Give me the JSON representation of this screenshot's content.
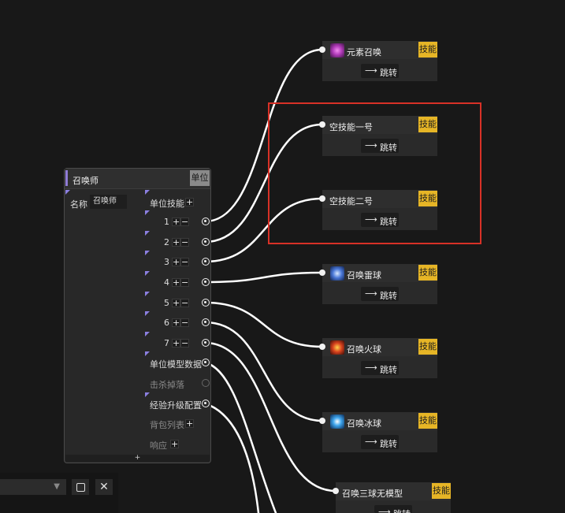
{
  "unit_node": {
    "title": "召唤师",
    "type_label": "单位",
    "name_label": "名称",
    "name_value": "召唤师",
    "skills_label": "单位技能",
    "skill_slots": [
      "1",
      "2",
      "3",
      "4",
      "5",
      "6",
      "7"
    ],
    "model_data_label": "单位模型数据",
    "kill_drop_label": "击杀掉落",
    "exp_config_label": "经验升级配置",
    "bag_list_label": "背包列表",
    "response_label": "响应",
    "plus": "+",
    "minus": "−",
    "footer": "+"
  },
  "skill_nodes": [
    {
      "title": "元素召唤",
      "badge": "技能",
      "jump_label": "跳转",
      "icon": "purple-element-icon",
      "icon_color": "#b03ab8"
    },
    {
      "title": "空技能一号",
      "badge": "技能",
      "jump_label": "跳转",
      "icon": "",
      "icon_color": ""
    },
    {
      "title": "空技能二号",
      "badge": "技能",
      "jump_label": "跳转",
      "icon": "",
      "icon_color": ""
    },
    {
      "title": "召唤雷球",
      "badge": "技能",
      "jump_label": "跳转",
      "icon": "thunder-orb-icon",
      "icon_color": "#4a78d8"
    },
    {
      "title": "召唤火球",
      "badge": "技能",
      "jump_label": "跳转",
      "icon": "fire-orb-icon",
      "icon_color": "#d8421e"
    },
    {
      "title": "召唤冰球",
      "badge": "技能",
      "jump_label": "跳转",
      "icon": "ice-orb-icon",
      "icon_color": "#3fa6ee"
    },
    {
      "title": "召唤三球无模型",
      "badge": "技能",
      "jump_label": "跳转",
      "icon": "",
      "icon_color": ""
    }
  ],
  "colors": {
    "badge": "#e6b526",
    "wire": "#ffffff",
    "highlight": "#d83127",
    "port_marker": "#8b7fe0"
  },
  "bottom_panel": {
    "dropdown_arrow": "▼",
    "close": "✕"
  }
}
